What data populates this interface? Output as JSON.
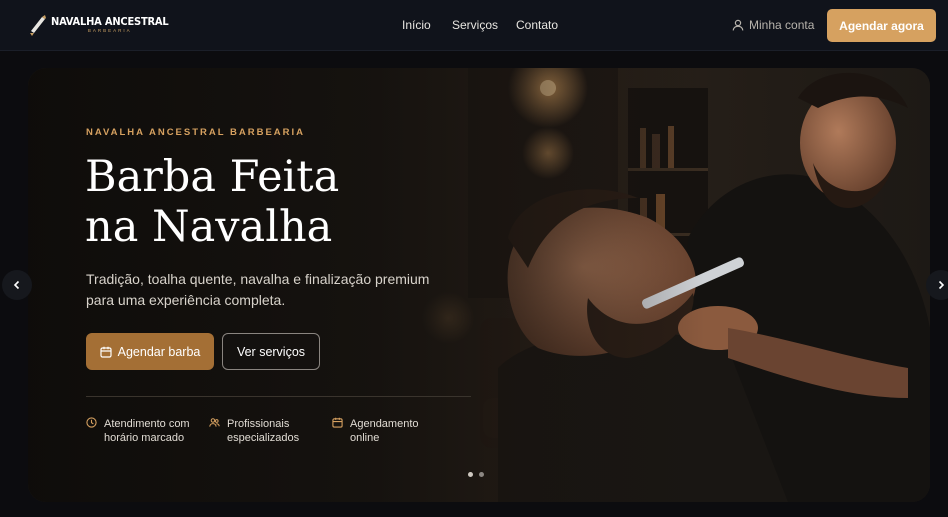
{
  "header": {
    "logo_name": "NAVALHA ANCESTRAL",
    "logo_sub": "BARBEARIA",
    "nav": [
      {
        "label": "Início"
      },
      {
        "label": "Serviços"
      },
      {
        "label": "Contato"
      }
    ],
    "account_label": "Minha conta",
    "cta_label": "Agendar agora"
  },
  "hero": {
    "eyebrow": "NAVALHA ANCESTRAL BARBEARIA",
    "headline_line1": "Barba Feita",
    "headline_line2": "na Navalha",
    "subtitle": "Tradição, toalha quente, navalha e finalização premium para uma experiência completa.",
    "primary_button": "Agendar barba",
    "secondary_button": "Ver serviços",
    "features": [
      {
        "icon": "clock-icon",
        "line1": "Atendimento com",
        "line2": "horário marcado"
      },
      {
        "icon": "users-icon",
        "line1": "Profissionais",
        "line2": "especializados"
      },
      {
        "icon": "calendar-icon",
        "line1": "Agendamento",
        "line2": "online"
      }
    ],
    "slides_total": 2,
    "slide_active": 1
  },
  "colors": {
    "accent": "#d6a160",
    "accent_dark": "#a46f35",
    "background": "#0c0c0f",
    "header": "#10131b"
  }
}
